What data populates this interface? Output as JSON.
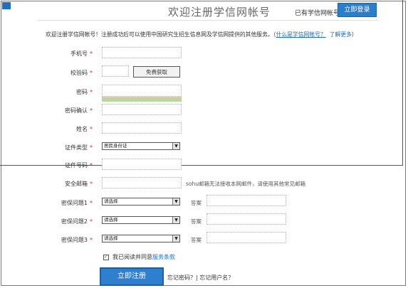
{
  "header": {
    "title": "欢迎注册学信网帐号",
    "have_account": "已有学信网帐号",
    "login_button": "立即登录"
  },
  "intro": {
    "text": "欢迎注册学信网帐号！注册成功后可以使用中国研究生招生信息网及学信网提供的其他服务。（",
    "link1": "什么是学信网帐号？",
    "link2": "了解更多",
    "close": "）"
  },
  "form": {
    "phone_label": "手机号",
    "code_label": "校验码",
    "code_button": "免费获取",
    "password_label": "密码",
    "confirm_label": "密码确认",
    "name_label": "姓名",
    "idtype_label": "证件类型",
    "idtype_value": "居民身份证",
    "idnum_label": "证件号码",
    "email_label": "安全邮箱",
    "email_note": "sohu邮箱无法接收本网邮件，请使用其他常见邮箱",
    "q1_label": "密保问题1",
    "q2_label": "密保问题2",
    "q3_label": "密保问题3",
    "select_placeholder": "请选择",
    "answer_label": "答案",
    "required_mark": "*"
  },
  "agree": {
    "checkbox": "✓",
    "text": "我已阅读并同意",
    "terms": "服务条款"
  },
  "footer": {
    "register_button": "立即注册",
    "forgot_text": "忘记密码？| 忘记用户名？"
  },
  "colors": {
    "accent": "#2a7fcc",
    "link": "#1a6cc2",
    "required": "#d22233"
  }
}
